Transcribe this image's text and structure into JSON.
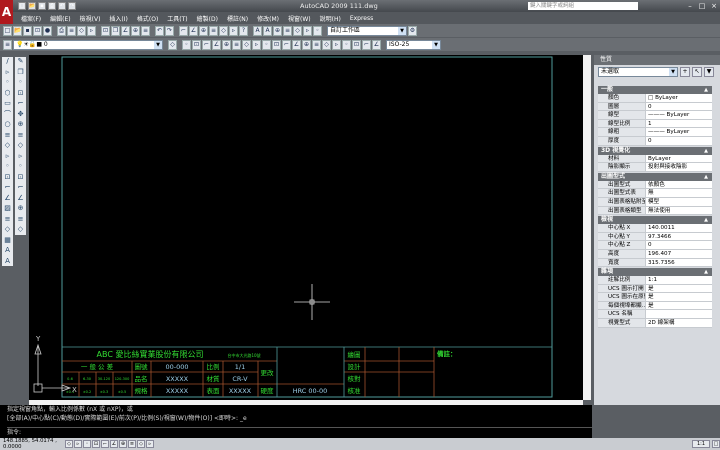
{
  "app": {
    "title": "AutoCAD 2009  111.dwg",
    "logo": "A",
    "search_placeholder": "鍵入關鍵字或詞組"
  },
  "menu": [
    "檔案(F)",
    "編輯(E)",
    "檢視(V)",
    "插入(I)",
    "格式(O)",
    "工具(T)",
    "繪製(D)",
    "標註(N)",
    "修改(M)",
    "視窗(W)",
    "說明(H)",
    "Express"
  ],
  "toolbar": {
    "workspace": "自訂工作區",
    "layer": "0",
    "dimstyle": "ISO-25"
  },
  "icons": {
    "qat": [
      "new-icon",
      "open-icon",
      "save-icon",
      "print-icon",
      "undo-icon",
      "redo-icon"
    ],
    "row1": [
      "new-icon",
      "open-icon",
      "save-icon",
      "saveas-icon",
      "stop-icon",
      "sep",
      "print-icon",
      "preview-icon",
      "publish-icon",
      "3dprint-icon",
      "sep",
      "cut-icon",
      "copy-icon",
      "paste-icon",
      "matchprop-icon",
      "blockeditor-icon",
      "sep",
      "undo-icon",
      "redo-icon",
      "sep",
      "pan-icon",
      "zoom-realtime-icon",
      "zoom-window-icon",
      "zoom-previous-icon",
      "sheetset-icon",
      "toolpalette-icon",
      "help-icon",
      "sep",
      "text-icon",
      "mtext-icon",
      "find-icon",
      "spell-icon",
      "scale-text-icon",
      "justify-icon",
      "convert-icon"
    ],
    "row2": [
      "layer-manager-icon",
      "sep",
      "dim-linear-icon",
      "dim-aligned-icon",
      "dim-arc-icon",
      "dim-ordinate-icon",
      "dim-radius-icon",
      "dim-jogged-icon",
      "dim-diameter-icon",
      "dim-angular-icon",
      "quick-dim-icon",
      "baseline-icon",
      "continue-icon",
      "dim-space-icon",
      "dim-break-icon",
      "tolerance-icon",
      "center-mark-icon",
      "inspect-icon",
      "jogged-linear-icon",
      "dim-edit-icon",
      "dim-text-edit-icon",
      "dim-update-icon"
    ],
    "draw": [
      "line-icon",
      "construction-line-icon",
      "polyline-icon",
      "polygon-icon",
      "rectangle-icon",
      "arc-icon",
      "circle-icon",
      "revcloud-icon",
      "spline-icon",
      "ellipse-icon",
      "ellipse-arc-icon",
      "insert-block-icon",
      "make-block-icon",
      "point-icon",
      "hatch-icon",
      "gradient-icon",
      "region-icon",
      "table-icon",
      "mtext-icon",
      "text-icon"
    ],
    "modify": [
      "erase-icon",
      "copy-icon",
      "mirror-icon",
      "offset-icon",
      "array-icon",
      "move-icon",
      "rotate-icon",
      "scale-icon",
      "stretch-icon",
      "trim-icon",
      "extend-icon",
      "break-at-point-icon",
      "break-icon",
      "join-icon",
      "chamfer-icon",
      "fillet-icon",
      "explode-icon"
    ],
    "status": [
      "snap-icon",
      "grid-icon",
      "ortho-icon",
      "polar-icon",
      "osnap-icon",
      "otrack-icon",
      "ducs-icon",
      "dyn-icon",
      "lineweight-icon",
      "qp-icon"
    ]
  },
  "properties": {
    "title": "性質",
    "selection": "未選取",
    "sections": [
      {
        "title": "一般",
        "rows": [
          [
            "顏色",
            "□ ByLayer"
          ],
          [
            "圖層",
            "0"
          ],
          [
            "線型",
            "——— ByLayer"
          ],
          [
            "線型比例",
            "1"
          ],
          [
            "線粗",
            "——— ByLayer"
          ],
          [
            "厚度",
            "0"
          ]
        ]
      },
      {
        "title": "3D 視覺化",
        "rows": [
          [
            "材料",
            "ByLayer"
          ],
          [
            "陰影顯示",
            "投射與接收陰影"
          ]
        ]
      },
      {
        "title": "出圖型式",
        "rows": [
          [
            "出圖型式",
            "依顏色"
          ],
          [
            "出圖型式表",
            "無"
          ],
          [
            "出圖表格貼附至",
            "模型"
          ],
          [
            "出圖表格類型",
            "無法使用"
          ]
        ]
      },
      {
        "title": "檢視",
        "rows": [
          [
            "中心點 X",
            "140.0011"
          ],
          [
            "中心點 Y",
            "97.3466"
          ],
          [
            "中心點 Z",
            "0"
          ],
          [
            "高度",
            "196.407"
          ],
          [
            "寬度",
            "315.7356"
          ]
        ]
      },
      {
        "title": "雜項",
        "rows": [
          [
            "註解比例",
            "1:1"
          ],
          [
            "UCS 圖示打開",
            "是"
          ],
          [
            "UCS 圖示在原點",
            "是"
          ],
          [
            "每個視埠都顯...",
            "是"
          ],
          [
            "UCS 名稱",
            ""
          ],
          [
            "視覺型式",
            "2D 線架構"
          ]
        ]
      }
    ]
  },
  "titleblock": {
    "company": "ABC 愛比絲實業股份有限公司",
    "address": "台中市大光路10號",
    "general_tol": "一 般 公 差",
    "drawing_no_label": "圖號",
    "drawing_no": "00-000",
    "scale_label": "比例",
    "scale": "1/1",
    "revision_label": "更改",
    "ranges": [
      "0-6",
      "6-30",
      "30-120",
      "120-300"
    ],
    "tols": [
      "±0.1",
      "±0.2",
      "±0.3",
      "±0.5"
    ],
    "part_label": "品名",
    "part": "XXXXX",
    "material_label": "材質",
    "material": "CR-V",
    "spec_label": "規格",
    "spec": "XXXXX",
    "surface_label": "表面",
    "surface": "XXXXX",
    "hardness_label": "硬度",
    "hardness": "HRC 00-00",
    "drawn": "繪圖",
    "designed": "設計",
    "checked": "核對",
    "approved": "核准",
    "notes": "備註："
  },
  "ucs": {
    "x": "X",
    "y": "Y"
  },
  "command": {
    "line1": "指定視窗角點，輸入比例係數 (nX 或 nXP)，或",
    "line2": "[全部(A)/中心點(C)/動態(D)/實際範圍(E)/前次(P)/比例(S)/視窗(W)/物件(O)] <即時>: _e",
    "prompt": "指令:"
  },
  "status": {
    "coords": "148.1885, 54.0174 , 0.0000",
    "annotation_scale": "1:1"
  },
  "colors": {
    "canvas": "#000000",
    "frame": "#4f9b9b",
    "titleblock_lines": "#a0522d",
    "titleblock_text": "#33dd33",
    "values": "#9ecfe8"
  }
}
